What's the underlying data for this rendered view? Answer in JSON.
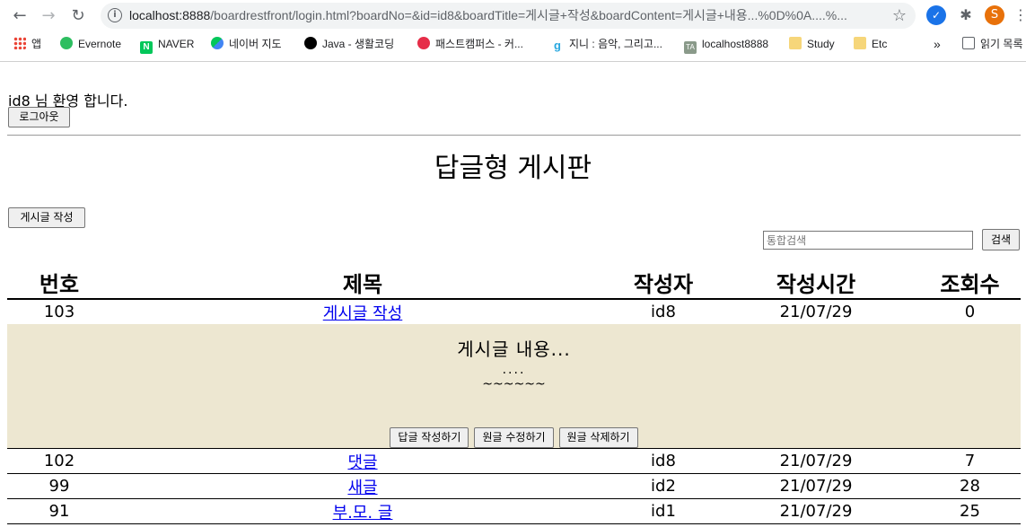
{
  "browser": {
    "url_host": "localhost:8888",
    "url_rest": "/boardrestfront/login.html?boardNo=&id=id8&boardTitle=게시글+작성&boardContent=게시글+내용...%0D%0A....%...",
    "bookmarks": [
      {
        "label": "앱"
      },
      {
        "label": "Evernote"
      },
      {
        "label": "NAVER"
      },
      {
        "label": "네이버 지도"
      },
      {
        "label": "Java - 생활코딩"
      },
      {
        "label": "패스트캠퍼스 - 커..."
      },
      {
        "label": "지니 : 음악, 그리고..."
      },
      {
        "label": "localhost8888"
      },
      {
        "label": "Study"
      },
      {
        "label": "Etc"
      }
    ],
    "more_label": "»",
    "reading_list": "읽기 목록",
    "profile_initial": "S",
    "bookmark_icon_letters": {
      "naver": "N",
      "genie": "g",
      "localhost": "TA"
    }
  },
  "header": {
    "welcome": "id8 님 환영 합니다.",
    "logout_label": "로그아웃"
  },
  "board": {
    "title": "답글형 게시판",
    "write_label": "게시글 작성",
    "search_placeholder": "통합검색",
    "search_label": "검색",
    "columns": [
      "번호",
      "제목",
      "작성자",
      "작성시간",
      "조회수"
    ],
    "rows": [
      {
        "no": "103",
        "title": "게시글 작성",
        "author": "id8",
        "time": "21/07/29",
        "views": "0"
      },
      {
        "no": "102",
        "title": "댓글",
        "author": "id8",
        "time": "21/07/29",
        "views": "7"
      },
      {
        "no": "99",
        "title": "새글",
        "author": "id2",
        "time": "21/07/29",
        "views": "28"
      },
      {
        "no": "91",
        "title": "부.모. 글",
        "author": "id1",
        "time": "21/07/29",
        "views": "25"
      }
    ],
    "detail": {
      "content_line1": "게시글 내용...",
      "content_line2": "....",
      "content_line3": "~~~~~~",
      "reply_label": "답글 작성하기",
      "edit_label": "원글 수정하기",
      "delete_label": "원글 삭제하기"
    }
  },
  "colors": {
    "detail_bg": "#ede7d1",
    "link": "#0000ee",
    "button_bg": "#efefef"
  }
}
